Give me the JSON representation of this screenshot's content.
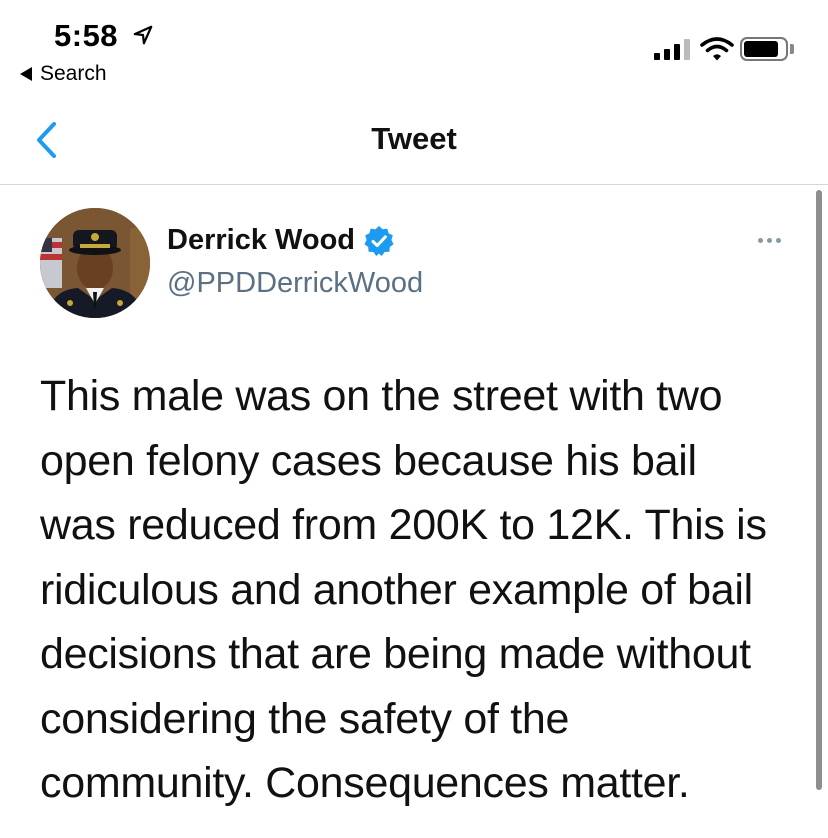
{
  "status_bar": {
    "time": "5:58",
    "back_label": "Search",
    "battery_level": 0.85,
    "icons": [
      "location-arrow-icon",
      "cellular-signal-icon",
      "wifi-icon",
      "battery-icon"
    ]
  },
  "nav": {
    "title": "Tweet",
    "back_icon": "chevron-left-icon"
  },
  "tweet": {
    "author_name": "Derrick Wood",
    "handle": "@PPDDerrickWood",
    "verified": true,
    "text_lines": [
      "This male was on the street with two",
      "open felony cases because his bail",
      "was reduced from 200K to 12K. This is",
      "ridiculous and another example of bail",
      "decisions that are being made without",
      "considering the safety of the",
      "community. Consequences matter."
    ]
  },
  "colors": {
    "accent": "#1d9bf0",
    "handle": "#5b7083",
    "divider": "#d4d6d8"
  }
}
